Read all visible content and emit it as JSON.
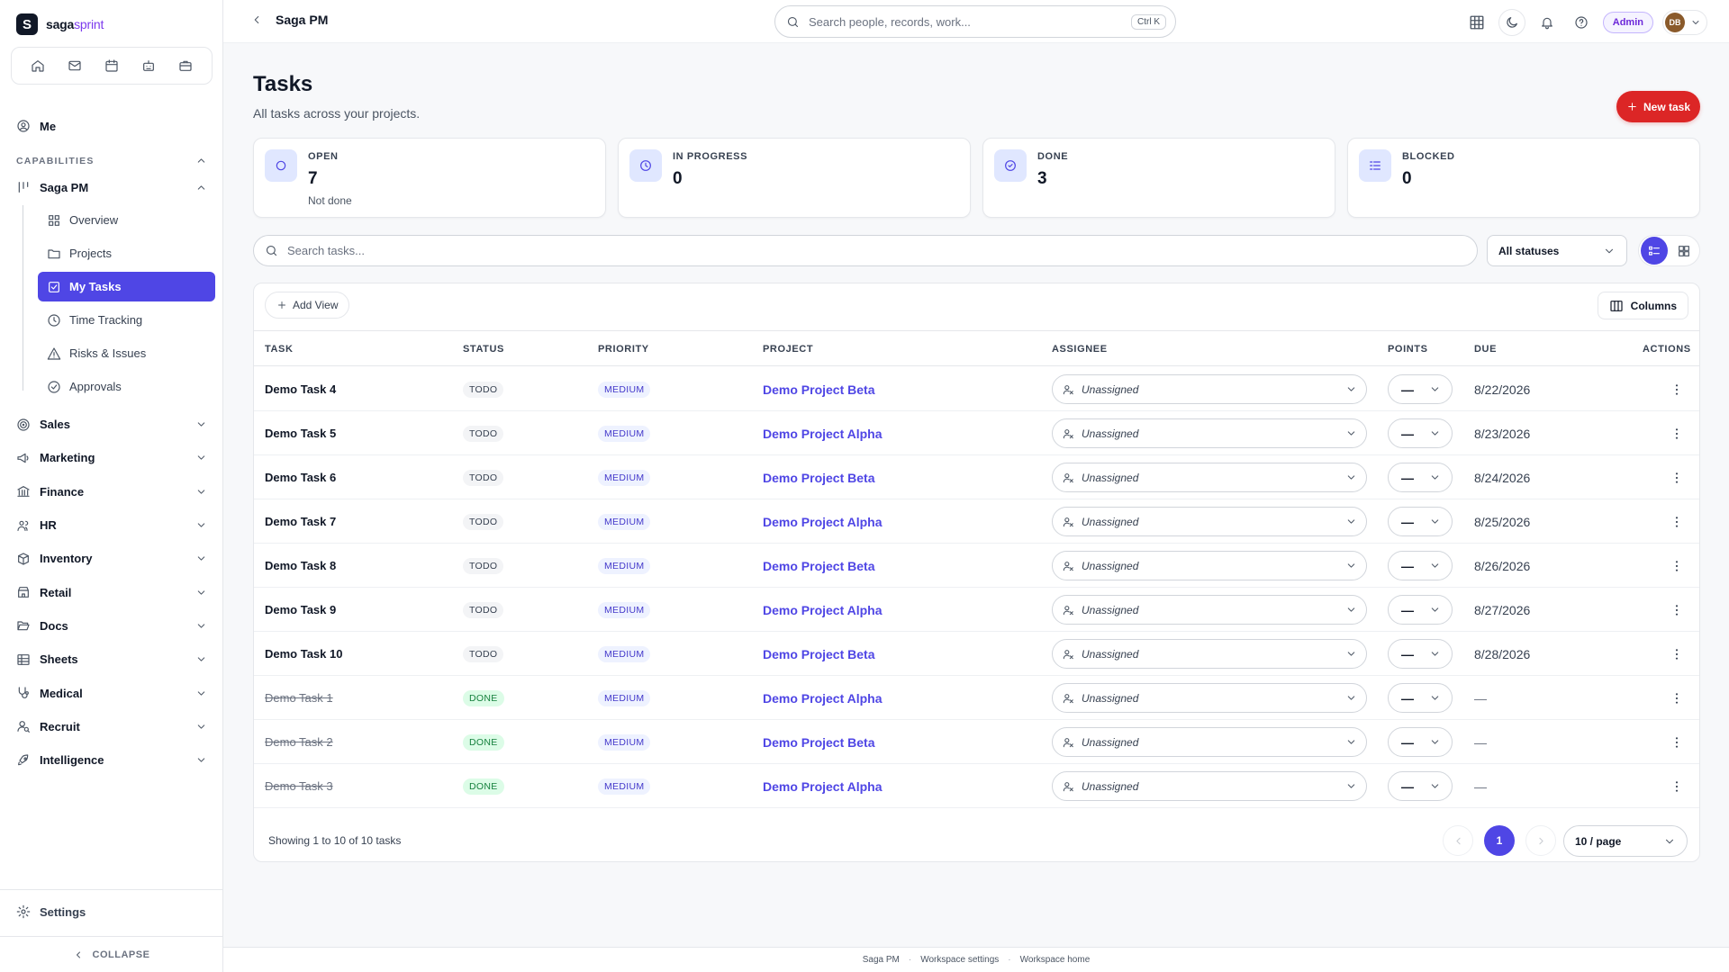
{
  "brand": {
    "name_main": "saga",
    "name_accent": "sprint",
    "logo_letter": "S"
  },
  "sidebar": {
    "quick_icons": [
      "home-icon",
      "mail-icon",
      "calendar-icon",
      "robot-icon",
      "briefcase-icon"
    ],
    "me": "Me",
    "capabilities_label": "CAPABILITIES",
    "saga_pm": "Saga PM",
    "sub_items": [
      {
        "label": "Overview",
        "icon": "grid-icon"
      },
      {
        "label": "Projects",
        "icon": "folder-icon"
      },
      {
        "label": "My Tasks",
        "icon": "checkbox-icon",
        "active": true
      },
      {
        "label": "Time Tracking",
        "icon": "clock-icon"
      },
      {
        "label": "Risks & Issues",
        "icon": "warning-icon"
      },
      {
        "label": "Approvals",
        "icon": "check-circle-icon"
      }
    ],
    "groups": [
      "Sales",
      "Marketing",
      "Finance",
      "HR",
      "Inventory",
      "Retail",
      "Docs",
      "Sheets",
      "Medical",
      "Recruit",
      "Intelligence"
    ],
    "settings": "Settings",
    "collapse": "COLLAPSE"
  },
  "topbar": {
    "title": "Saga PM",
    "search_placeholder": "Search people, records, work...",
    "shortcut": "Ctrl K",
    "admin": "Admin",
    "avatar_initials": "DB"
  },
  "page": {
    "title": "Tasks",
    "subtitle": "All tasks across your projects.",
    "new_task": "New task"
  },
  "stats": [
    {
      "label": "OPEN",
      "value": "7",
      "note": "Not done",
      "icon": "circle-icon"
    },
    {
      "label": "IN PROGRESS",
      "value": "0",
      "note": "",
      "icon": "clock-icon"
    },
    {
      "label": "DONE",
      "value": "3",
      "note": "",
      "icon": "check-circle-icon"
    },
    {
      "label": "BLOCKED",
      "value": "0",
      "note": "",
      "icon": "list-check-icon"
    }
  ],
  "filters": {
    "search_placeholder": "Search tasks...",
    "status": "All statuses"
  },
  "table": {
    "add_view": "Add View",
    "columns_button": "Columns",
    "headers": {
      "task": "TASK",
      "status": "STATUS",
      "priority": "PRIORITY",
      "project": "PROJECT",
      "assignee": "ASSIGNEE",
      "points": "POINTS",
      "due": "DUE",
      "actions": "ACTIONS"
    },
    "rows": [
      {
        "task": "Demo Task 4",
        "status": "TODO",
        "priority": "MEDIUM",
        "project": "Demo Project Beta",
        "assignee": "Unassigned",
        "points": "—",
        "due": "8/22/2026",
        "done": false
      },
      {
        "task": "Demo Task 5",
        "status": "TODO",
        "priority": "MEDIUM",
        "project": "Demo Project Alpha",
        "assignee": "Unassigned",
        "points": "—",
        "due": "8/23/2026",
        "done": false
      },
      {
        "task": "Demo Task 6",
        "status": "TODO",
        "priority": "MEDIUM",
        "project": "Demo Project Beta",
        "assignee": "Unassigned",
        "points": "—",
        "due": "8/24/2026",
        "done": false
      },
      {
        "task": "Demo Task 7",
        "status": "TODO",
        "priority": "MEDIUM",
        "project": "Demo Project Alpha",
        "assignee": "Unassigned",
        "points": "—",
        "due": "8/25/2026",
        "done": false
      },
      {
        "task": "Demo Task 8",
        "status": "TODO",
        "priority": "MEDIUM",
        "project": "Demo Project Beta",
        "assignee": "Unassigned",
        "points": "—",
        "due": "8/26/2026",
        "done": false
      },
      {
        "task": "Demo Task 9",
        "status": "TODO",
        "priority": "MEDIUM",
        "project": "Demo Project Alpha",
        "assignee": "Unassigned",
        "points": "—",
        "due": "8/27/2026",
        "done": false
      },
      {
        "task": "Demo Task 10",
        "status": "TODO",
        "priority": "MEDIUM",
        "project": "Demo Project Beta",
        "assignee": "Unassigned",
        "points": "—",
        "due": "8/28/2026",
        "done": false
      },
      {
        "task": "Demo Task 1",
        "status": "DONE",
        "priority": "MEDIUM",
        "project": "Demo Project Alpha",
        "assignee": "Unassigned",
        "points": "—",
        "due": "—",
        "done": true
      },
      {
        "task": "Demo Task 2",
        "status": "DONE",
        "priority": "MEDIUM",
        "project": "Demo Project Beta",
        "assignee": "Unassigned",
        "points": "—",
        "due": "—",
        "done": true
      },
      {
        "task": "Demo Task 3",
        "status": "DONE",
        "priority": "MEDIUM",
        "project": "Demo Project Alpha",
        "assignee": "Unassigned",
        "points": "—",
        "due": "—",
        "done": true
      }
    ],
    "showing": "Showing 1 to 10 of 10 tasks",
    "current_page": "1",
    "per_page": "10 / page"
  },
  "footer": {
    "links": [
      "Saga PM",
      "Workspace settings",
      "Workspace home"
    ]
  },
  "colors": {
    "accent": "#4f46e5",
    "danger": "#dc2626",
    "done_green": "#15803d"
  }
}
